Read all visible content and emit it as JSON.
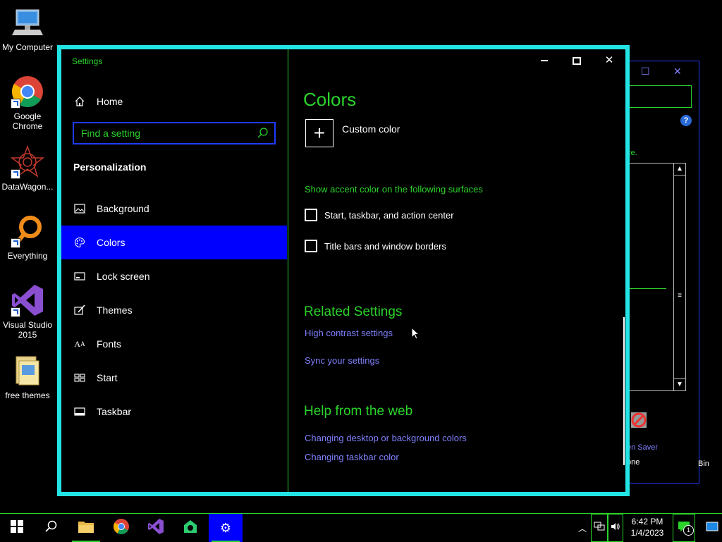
{
  "desktop": {
    "icons": [
      {
        "label": "My Computer"
      },
      {
        "label": "Google Chrome"
      },
      {
        "label": "DataWagon..."
      },
      {
        "label": "Everything"
      },
      {
        "label": "Visual Studio 2015"
      },
      {
        "label": "free themes"
      }
    ]
  },
  "background_window": {
    "text_fragment": "ce.",
    "screen_saver_label": "en Saver",
    "screen_saver_value": "one",
    "recycle_fragment": "Bin"
  },
  "settings": {
    "window_title": "Settings",
    "home_label": "Home",
    "search": {
      "placeholder": "Find a setting"
    },
    "section_header": "Personalization",
    "nav": [
      {
        "label": "Background",
        "icon": "picture-icon"
      },
      {
        "label": "Colors",
        "icon": "palette-icon",
        "active": true
      },
      {
        "label": "Lock screen",
        "icon": "lock-screen-icon"
      },
      {
        "label": "Themes",
        "icon": "brush-icon"
      },
      {
        "label": "Fonts",
        "icon": "font-icon"
      },
      {
        "label": "Start",
        "icon": "start-icon"
      },
      {
        "label": "Taskbar",
        "icon": "taskbar-icon"
      }
    ],
    "content": {
      "title": "Colors",
      "custom_color_label": "Custom color",
      "accent_header": "Show accent color on the following surfaces",
      "checkboxes": [
        {
          "label": "Start, taskbar, and action center",
          "checked": false
        },
        {
          "label": "Title bars and window borders",
          "checked": false
        }
      ],
      "related_header": "Related Settings",
      "related_links": [
        "High contrast settings",
        "Sync your settings"
      ],
      "help_header": "Help from the web",
      "help_links": [
        "Changing desktop or background colors",
        "Changing taskbar color"
      ]
    }
  },
  "taskbar": {
    "time": "6:42 PM",
    "date": "1/4/2023",
    "notification_count": "1"
  },
  "colors": {
    "accent_green": "#2bd42b",
    "window_border": "#23e4e4",
    "selection_blue": "#0000ff",
    "link": "#8080ff"
  }
}
